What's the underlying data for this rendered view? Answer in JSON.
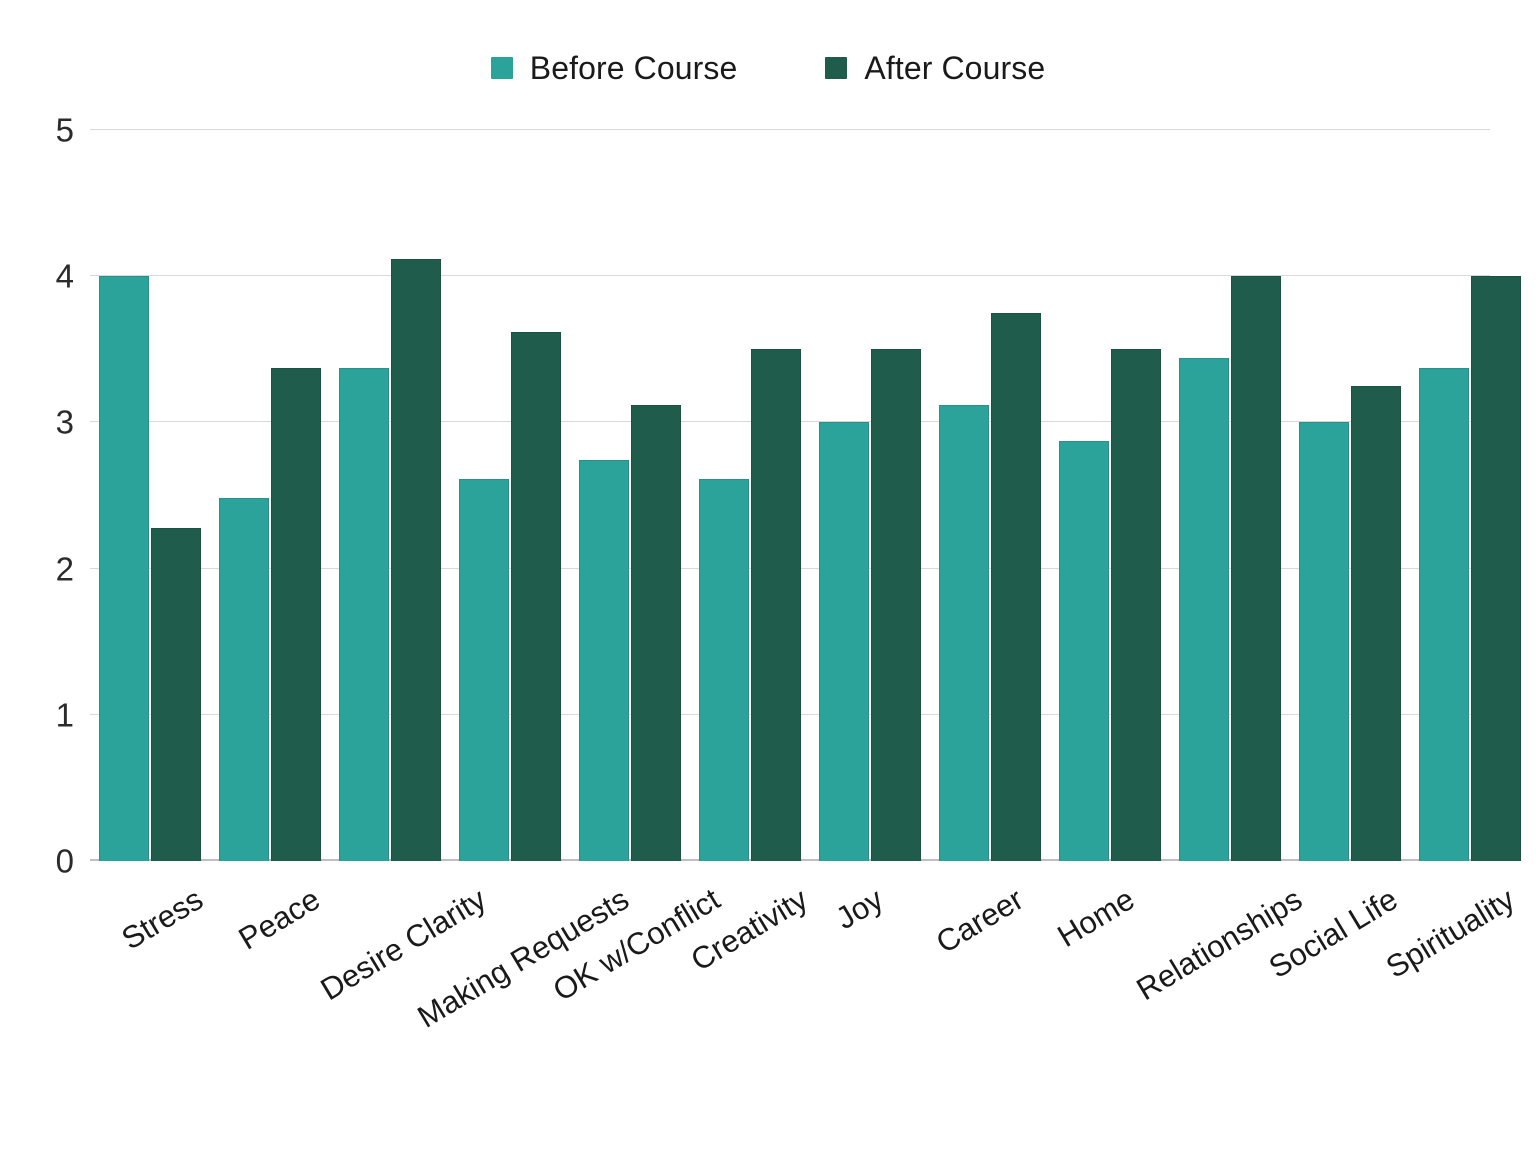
{
  "legend": {
    "items": [
      {
        "label": "Before Course",
        "color": "#2BA39B",
        "key": "before"
      },
      {
        "label": "After Course",
        "color": "#1F5C4C",
        "key": "after"
      }
    ]
  },
  "axis": {
    "y_ticks": [
      "0",
      "1",
      "2",
      "3",
      "4",
      "5"
    ]
  },
  "chart_data": {
    "type": "bar",
    "title": "",
    "subtitle": "",
    "xlabel": "",
    "ylabel": "",
    "ylim": [
      0,
      5
    ],
    "yticks": [
      0,
      1,
      2,
      3,
      4,
      5
    ],
    "grid": true,
    "legend_position": "top-center",
    "orientation": "vertical",
    "grouping": "grouped",
    "categories": [
      "Stress",
      "Peace",
      "Desire Clarity",
      "Making Requests",
      "OK w/Conflict",
      "Creativity",
      "Joy",
      "Career",
      "Home",
      "Relationships",
      "Social Life",
      "Spirituality"
    ],
    "series": [
      {
        "name": "Before Course",
        "color": "#2BA39B",
        "values": [
          4.0,
          2.48,
          3.37,
          2.61,
          2.74,
          2.61,
          3.0,
          3.12,
          2.87,
          3.44,
          3.0,
          3.37
        ]
      },
      {
        "name": "After Course",
        "color": "#1F5C4C",
        "values": [
          2.28,
          3.37,
          4.12,
          3.62,
          3.12,
          3.5,
          3.5,
          3.75,
          3.5,
          4.0,
          3.25,
          4.0
        ]
      }
    ]
  }
}
